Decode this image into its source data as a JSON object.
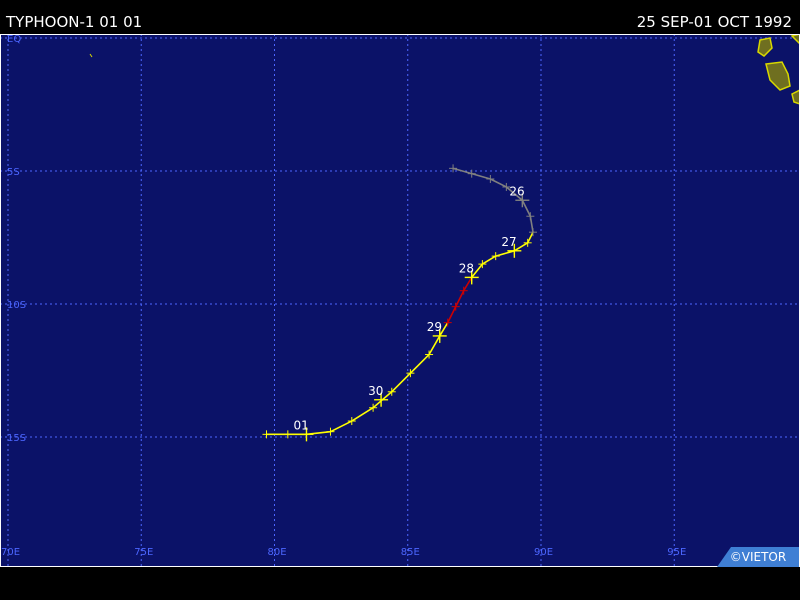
{
  "header": {
    "title": "TYPHOON-1 01 01",
    "date_range": "25 SEP-01 OCT 1992"
  },
  "credit": "©VIETOR",
  "map": {
    "lon_range": [
      70,
      100
    ],
    "lat_range": [
      0,
      -20
    ],
    "lat_labels": [
      {
        "lat": 0,
        "text": "EQ"
      },
      {
        "lat": -5,
        "text": "5S"
      },
      {
        "lat": -10,
        "text": "10S"
      },
      {
        "lat": -15,
        "text": "15S"
      }
    ],
    "lon_labels": [
      {
        "lon": 70,
        "text": "70E"
      },
      {
        "lon": 75,
        "text": "75E"
      },
      {
        "lon": 80,
        "text": "80E"
      },
      {
        "lon": 85,
        "text": "85E"
      },
      {
        "lon": 90,
        "text": "90E"
      },
      {
        "lon": 95,
        "text": "95E"
      }
    ],
    "colors": {
      "ocean": "#0b1268",
      "grid": "#4c66ff",
      "frame": "#ffffff",
      "land": "#6f6f20",
      "land_edge": "#d8d800",
      "track_depression": "#808080",
      "track_storm": "#ffff00",
      "track_typhoon": "#cc0000",
      "day_label": "#ffffff"
    }
  },
  "track": {
    "points": [
      {
        "lon": 86.7,
        "lat": -4.9,
        "cat": "depression"
      },
      {
        "lon": 87.4,
        "lat": -5.1,
        "cat": "depression"
      },
      {
        "lon": 88.1,
        "lat": -5.3,
        "cat": "depression"
      },
      {
        "lon": 88.7,
        "lat": -5.6,
        "cat": "depression"
      },
      {
        "lon": 89.3,
        "lat": -6.1,
        "cat": "depression"
      },
      {
        "lon": 89.6,
        "lat": -6.7,
        "cat": "depression"
      },
      {
        "lon": 89.7,
        "lat": -7.3,
        "cat": "depression"
      },
      {
        "lon": 89.5,
        "lat": -7.7,
        "cat": "storm"
      },
      {
        "lon": 89.0,
        "lat": -8.0,
        "cat": "storm"
      },
      {
        "lon": 88.3,
        "lat": -8.2,
        "cat": "storm"
      },
      {
        "lon": 87.8,
        "lat": -8.5,
        "cat": "storm"
      },
      {
        "lon": 87.4,
        "lat": -9.0,
        "cat": "storm"
      },
      {
        "lon": 87.1,
        "lat": -9.5,
        "cat": "typhoon"
      },
      {
        "lon": 86.8,
        "lat": -10.1,
        "cat": "typhoon"
      },
      {
        "lon": 86.5,
        "lat": -10.7,
        "cat": "typhoon"
      },
      {
        "lon": 86.2,
        "lat": -11.2,
        "cat": "storm"
      },
      {
        "lon": 85.8,
        "lat": -11.9,
        "cat": "storm"
      },
      {
        "lon": 85.1,
        "lat": -12.6,
        "cat": "storm"
      },
      {
        "lon": 84.4,
        "lat": -13.3,
        "cat": "storm"
      },
      {
        "lon": 83.7,
        "lat": -13.9,
        "cat": "storm"
      },
      {
        "lon": 82.9,
        "lat": -14.4,
        "cat": "storm"
      },
      {
        "lon": 82.1,
        "lat": -14.8,
        "cat": "storm"
      },
      {
        "lon": 81.2,
        "lat": -14.9,
        "cat": "storm"
      },
      {
        "lon": 80.5,
        "lat": -14.9,
        "cat": "storm"
      },
      {
        "lon": 79.7,
        "lat": -14.9,
        "cat": "storm"
      }
    ],
    "day_marks": [
      {
        "lon": 89.3,
        "lat": -6.1,
        "label": "26",
        "cat": "depression"
      },
      {
        "lon": 89.0,
        "lat": -8.0,
        "label": "27",
        "cat": "storm"
      },
      {
        "lon": 87.4,
        "lat": -9.0,
        "label": "28",
        "cat": "storm"
      },
      {
        "lon": 86.2,
        "lat": -11.2,
        "label": "29",
        "cat": "storm"
      },
      {
        "lon": 84.0,
        "lat": -13.6,
        "label": "30",
        "cat": "storm"
      },
      {
        "lon": 81.2,
        "lat": -14.9,
        "label": "01",
        "cat": "storm"
      }
    ]
  }
}
